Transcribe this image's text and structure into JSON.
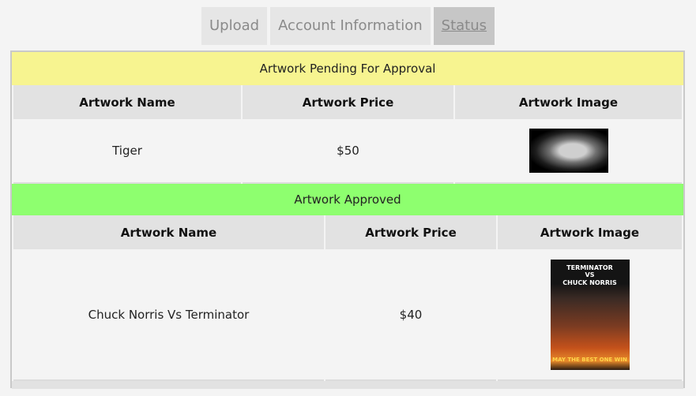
{
  "tabs": [
    {
      "label": "Upload",
      "active": false
    },
    {
      "label": "Account Information",
      "active": false
    },
    {
      "label": "Status",
      "active": true
    }
  ],
  "pending": {
    "title": "Artwork Pending For Approval",
    "color": "#f7f490",
    "columns": [
      "Artwork Name",
      "Artwork Price",
      "Artwork Image"
    ],
    "rows": [
      {
        "name": "Tiger",
        "price": "$50",
        "image": "tiger-image"
      }
    ]
  },
  "approved": {
    "title": "Artwork Approved",
    "color": "#8eff6f",
    "columns": [
      "Artwork Name",
      "Artwork Price",
      "Artwork Image"
    ],
    "rows": [
      {
        "name": "Chuck Norris Vs Terminator",
        "price": "$40",
        "image": "poster-image",
        "poster_text": [
          "TERMINATOR",
          "VS",
          "CHUCK NORRIS"
        ],
        "poster_tagline": "MAY THE BEST ONE WIN"
      }
    ]
  }
}
